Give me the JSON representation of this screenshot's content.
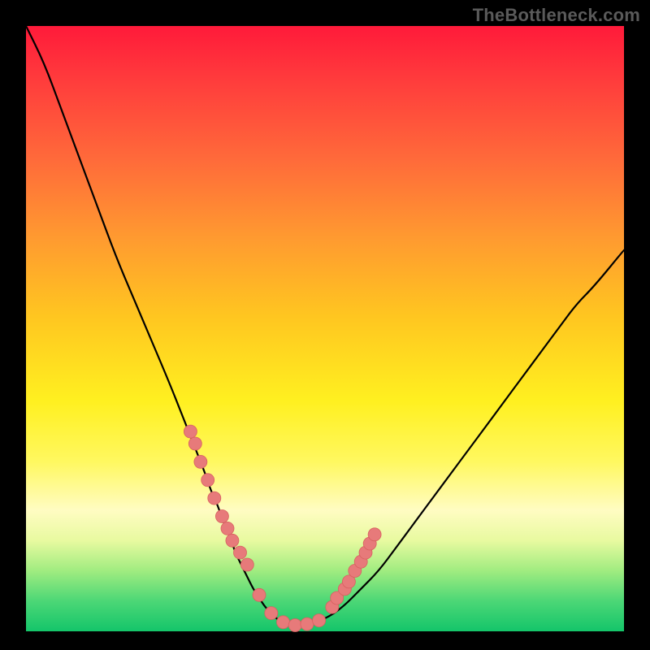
{
  "watermark": "TheBottleneck.com",
  "colors": {
    "gradient_top": "#ff1a3a",
    "gradient_bottom": "#14c56a",
    "curve": "#000000",
    "dot_fill": "#e77a7a",
    "dot_stroke": "#d86060",
    "frame": "#000000"
  },
  "chart_data": {
    "type": "line",
    "title": "",
    "xlabel": "",
    "ylabel": "",
    "xlim": [
      0,
      100
    ],
    "ylim": [
      0,
      100
    ],
    "grid": false,
    "x": [
      0,
      3,
      6,
      9,
      12,
      15,
      18,
      21,
      24,
      26,
      28,
      30,
      31,
      32,
      33,
      34,
      35,
      36,
      37,
      38,
      39,
      40,
      41,
      42,
      43,
      44,
      45,
      47,
      50,
      53,
      56,
      59,
      62,
      65,
      68,
      71,
      74,
      77,
      80,
      83,
      86,
      89,
      92,
      95,
      100
    ],
    "values": [
      100,
      94,
      86,
      78,
      70,
      62,
      55,
      48,
      41,
      36,
      31,
      26,
      23,
      21,
      18,
      16,
      13,
      11,
      9,
      7,
      5.5,
      4,
      3,
      2,
      1.5,
      1,
      1,
      1.2,
      2,
      4,
      7,
      10,
      14,
      18,
      22,
      26,
      30,
      34,
      38,
      42,
      46,
      50,
      54,
      57,
      63
    ],
    "markers_x": [
      27.5,
      28.3,
      29.2,
      30.4,
      31.5,
      32.8,
      33.7,
      34.5,
      35.8,
      37,
      39,
      41,
      43,
      45,
      47,
      49,
      51.2,
      52,
      53.3,
      54,
      55,
      56,
      56.8,
      57.5,
      58.3
    ],
    "markers_y": [
      33,
      31,
      28,
      25,
      22,
      19,
      17,
      15,
      13,
      11,
      6,
      3,
      1.5,
      1,
      1.2,
      1.8,
      4,
      5.5,
      7,
      8.2,
      10,
      11.5,
      13,
      14.5,
      16
    ]
  }
}
